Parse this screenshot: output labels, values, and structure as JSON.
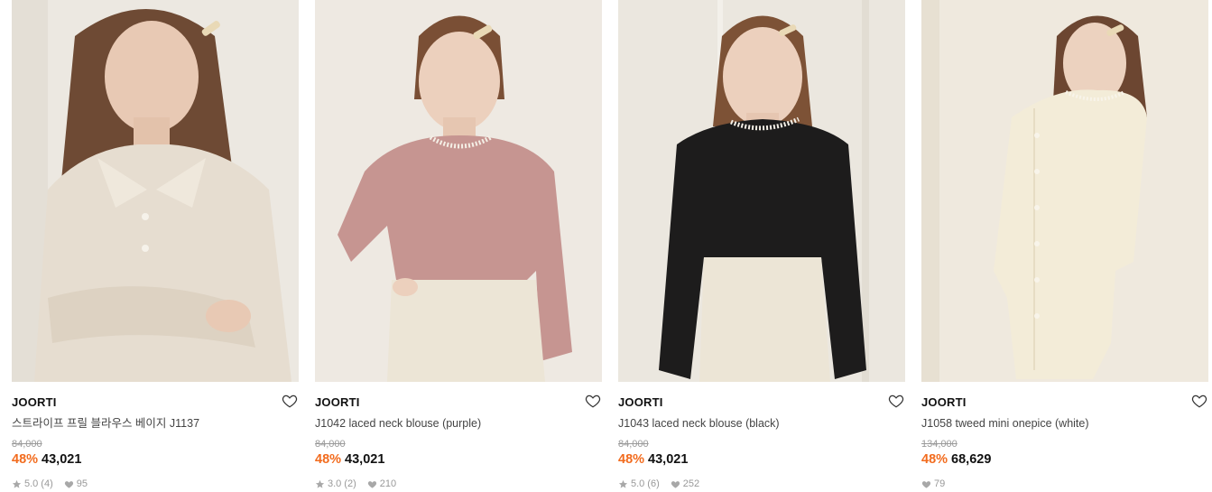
{
  "products": [
    {
      "brand": "JOORTI",
      "name": "스트라이프 프릴 블라우스 베이지 J1137",
      "original_price": "84,000",
      "discount": "48%",
      "price": "43,021",
      "rating": "5.0",
      "review_count": "(4)",
      "likes": "95",
      "photo_colors": {
        "bg": "#ece8e1",
        "garment": "#e6ddd0",
        "hair": "#6e4a34",
        "skin": "#e8c9b4"
      }
    },
    {
      "brand": "JOORTI",
      "name": "J1042 laced neck blouse (purple)",
      "original_price": "84,000",
      "discount": "48%",
      "price": "43,021",
      "rating": "3.0",
      "review_count": "(2)",
      "likes": "210",
      "photo_colors": {
        "bg": "#eee9e2",
        "garment": "#c69591",
        "hair": "#7a4f35",
        "skin": "#ecd0bd"
      }
    },
    {
      "brand": "JOORTI",
      "name": "J1043 laced neck blouse (black)",
      "original_price": "84,000",
      "discount": "48%",
      "price": "43,021",
      "rating": "5.0",
      "review_count": "(6)",
      "likes": "252",
      "photo_colors": {
        "bg": "#ebe7df",
        "garment": "#1d1c1c",
        "hair": "#7d5236",
        "skin": "#ecd0bd"
      }
    },
    {
      "brand": "JOORTI",
      "name": "J1058 tweed mini onepice (white)",
      "original_price": "134,000",
      "discount": "48%",
      "price": "68,629",
      "rating": "",
      "review_count": "",
      "likes": "79",
      "photo_colors": {
        "bg": "#efe9de",
        "garment": "#f3ecd8",
        "hair": "#6c4631",
        "skin": "#ecd2bf"
      }
    }
  ],
  "colors": {
    "discount": "#f26b1d",
    "price": "#111111",
    "muted": "#999999"
  },
  "icons": {
    "wishlist": "heart-outline-icon",
    "rating": "star-icon",
    "likes": "heart-filled-icon"
  }
}
